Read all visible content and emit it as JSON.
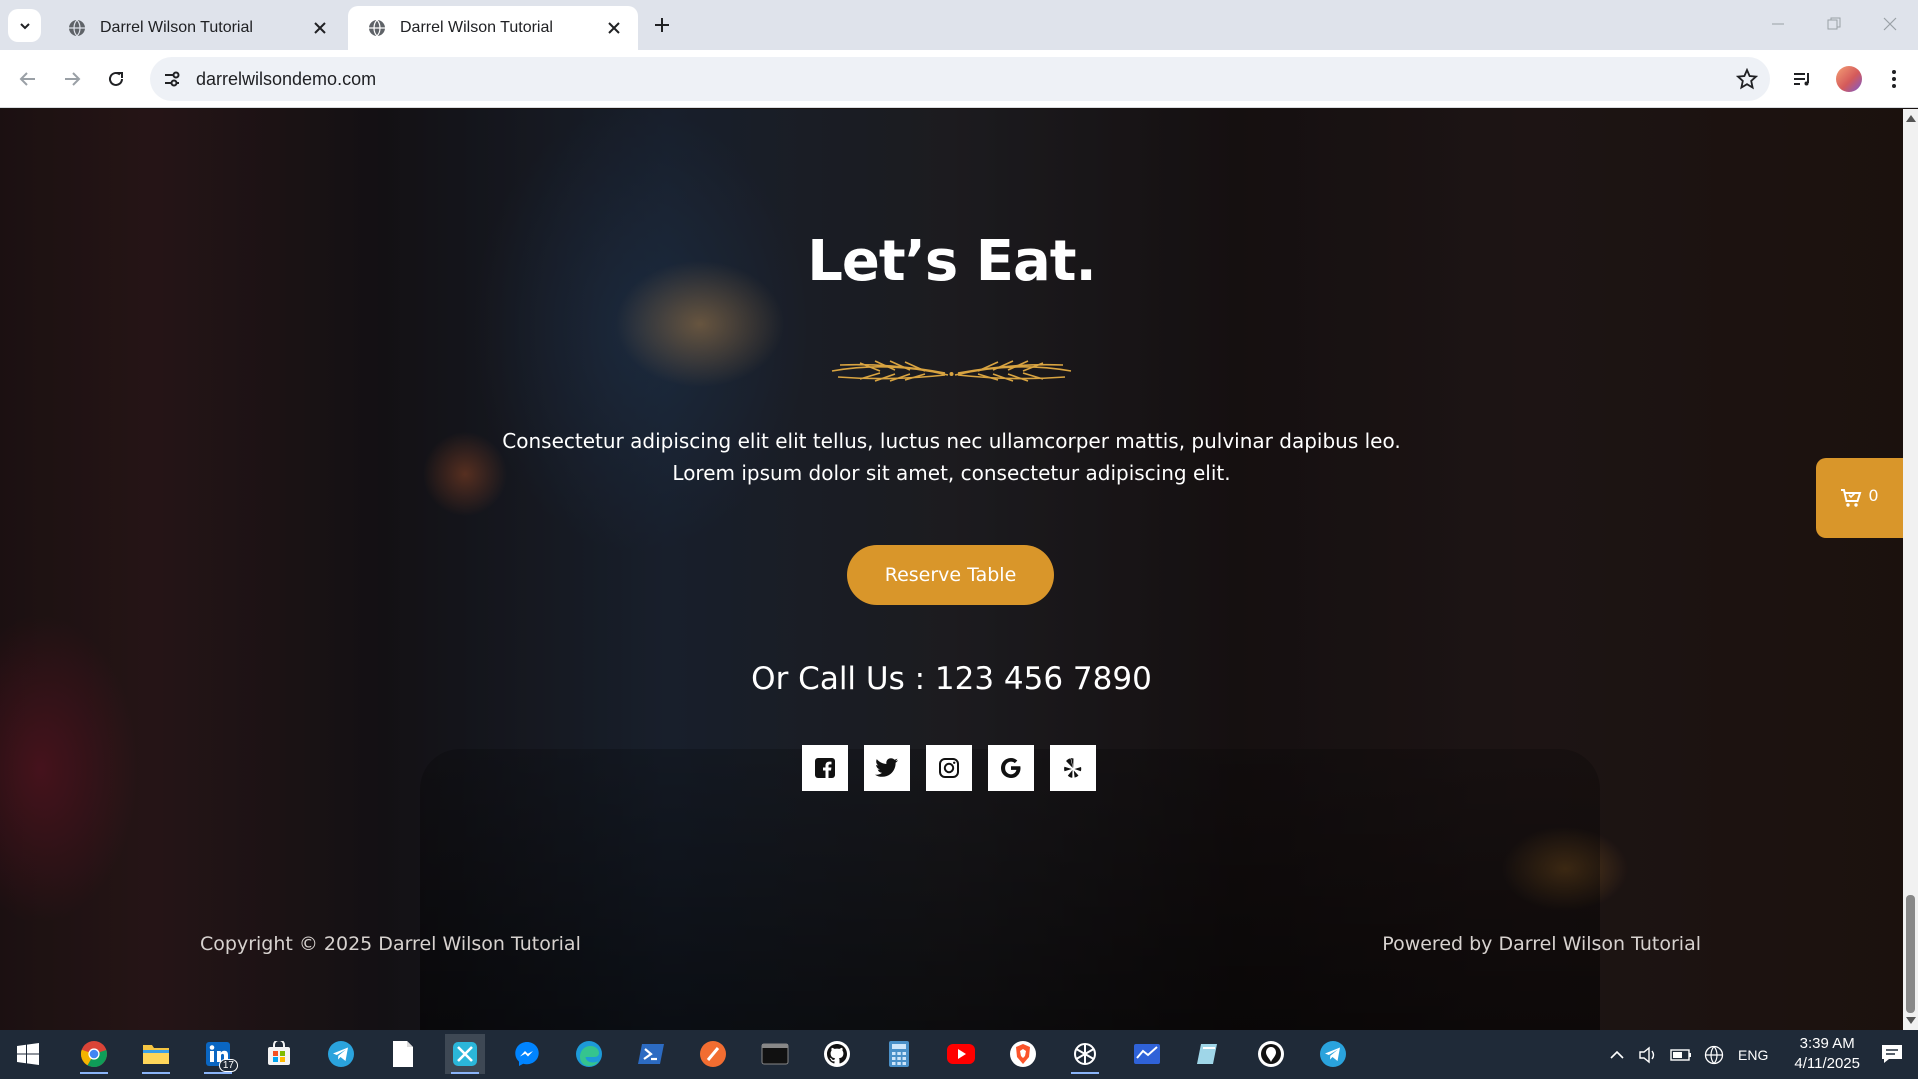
{
  "browser": {
    "tabs": [
      {
        "title": "Darrel Wilson Tutorial",
        "active": false
      },
      {
        "title": "Darrel Wilson Tutorial",
        "active": true
      }
    ],
    "url": "darrelwilsondemo.com"
  },
  "page": {
    "headline": "Let’s Eat.",
    "description_line1": "Consectetur adipiscing elit elit tellus, luctus nec ullamcorper mattis, pulvinar dapibus leo.",
    "description_line2": "Lorem ipsum dolor sit amet, consectetur adipiscing elit.",
    "reserve_button": "Reserve Table",
    "call_us": "Or Call Us : 123 456 7890",
    "socials": [
      "facebook-icon",
      "twitter-icon",
      "instagram-icon",
      "google-icon",
      "yelp-icon"
    ],
    "copyright": "Copyright © 2025 Darrel Wilson Tutorial",
    "powered_by": "Powered by Darrel Wilson Tutorial",
    "cart_count": "0",
    "accent_color": "#d9962a"
  },
  "taskbar": {
    "apps": [
      "start-icon",
      "chrome-icon",
      "file-explorer-icon",
      "linkedin-icon",
      "store-icon",
      "telegram-icon",
      "notepad-icon",
      "capcut-icon",
      "messenger-icon",
      "edge-icon",
      "powershell-icon",
      "app-orange-icon",
      "terminal-icon",
      "github-icon",
      "calculator-icon",
      "youtube-icon",
      "brave-icon",
      "chatgpt-icon",
      "app-blue-icon",
      "app-teal-icon",
      "app-black-icon",
      "telegram-2-icon"
    ],
    "linkedin_badge": "17",
    "language": "ENG",
    "time": "3:39 AM",
    "date": "4/11/2025"
  }
}
